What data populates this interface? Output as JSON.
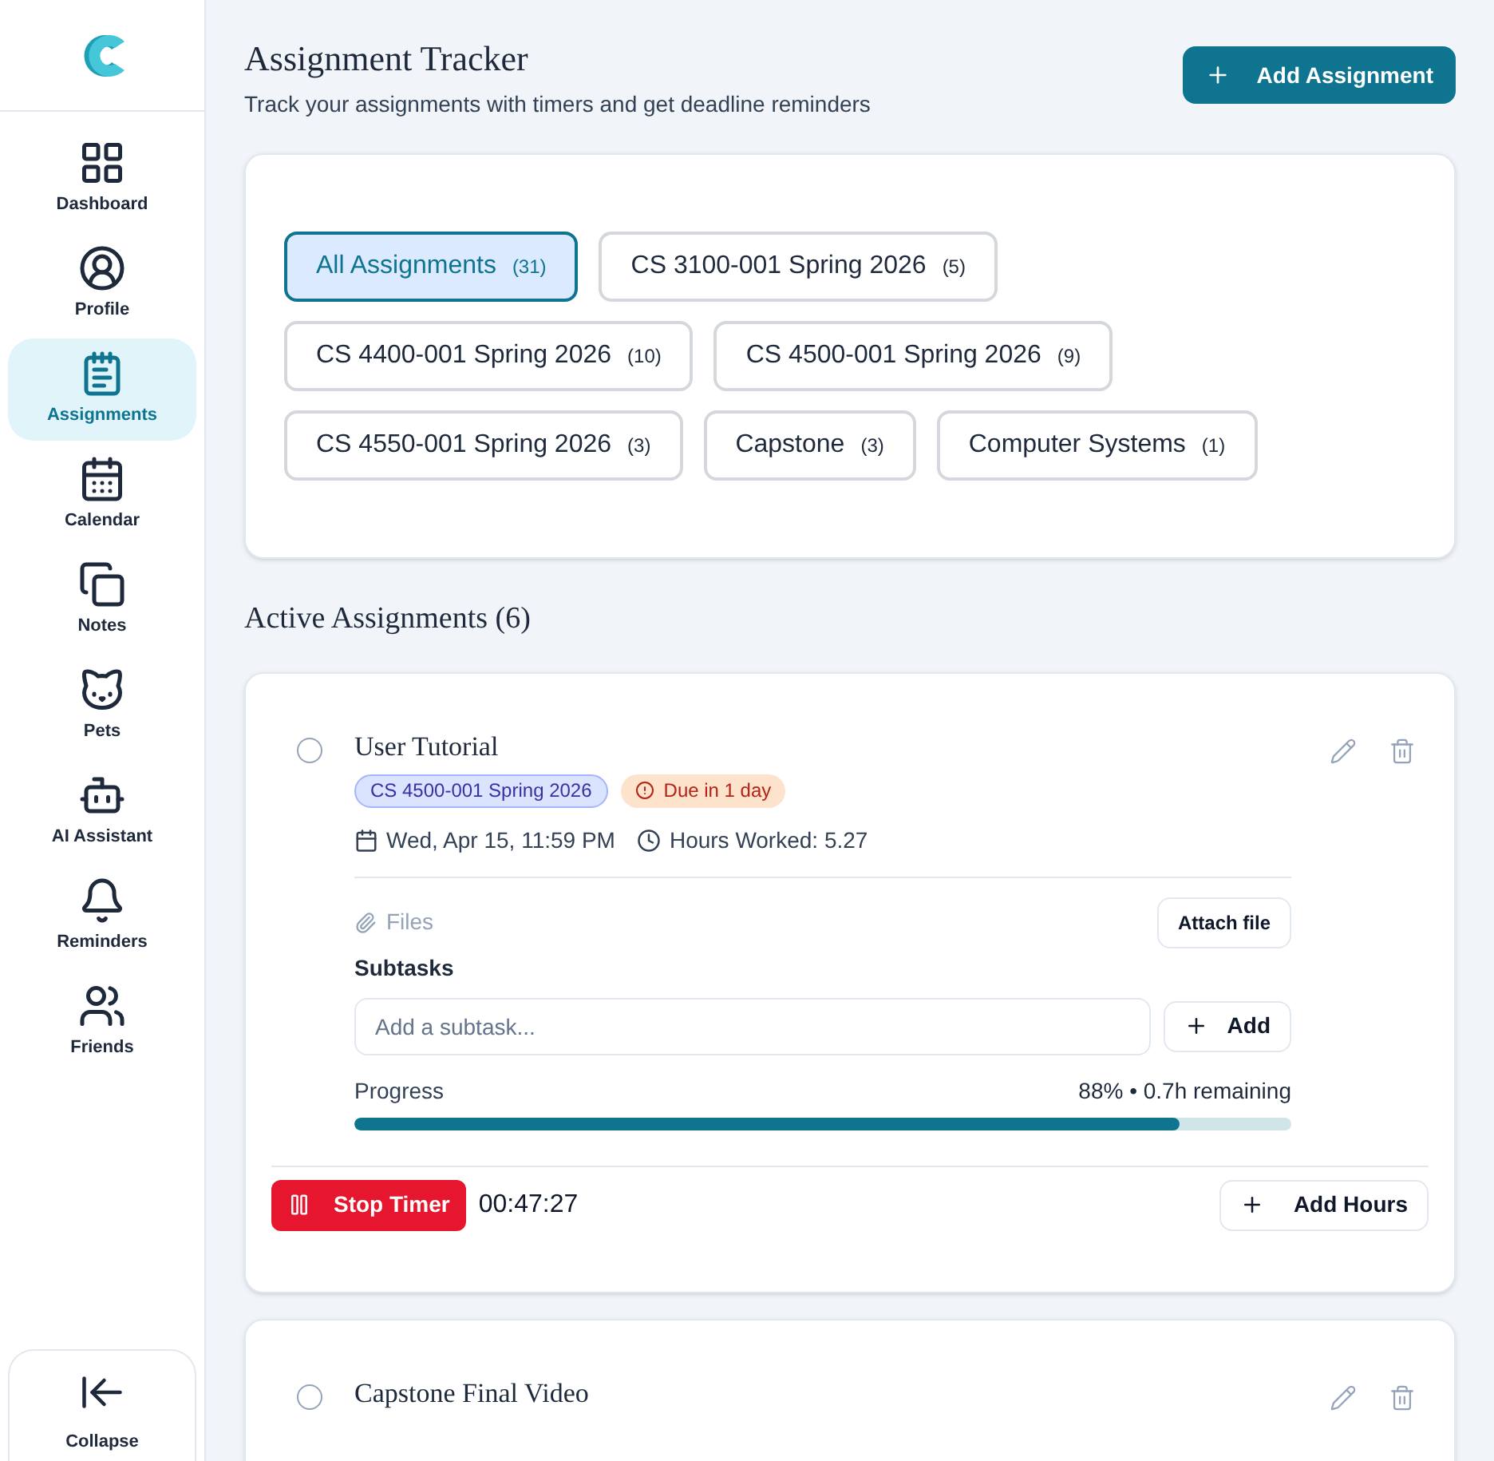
{
  "sidebar": {
    "items": [
      {
        "label": "Dashboard",
        "selected": false
      },
      {
        "label": "Profile",
        "selected": false
      },
      {
        "label": "Assignments",
        "selected": true
      },
      {
        "label": "Calendar",
        "selected": false
      },
      {
        "label": "Notes",
        "selected": false
      },
      {
        "label": "Pets",
        "selected": false
      },
      {
        "label": "AI Assistant",
        "selected": false
      },
      {
        "label": "Reminders",
        "selected": false
      },
      {
        "label": "Friends",
        "selected": false
      }
    ],
    "collapse": "Collapse"
  },
  "header": {
    "title": "Assignment Tracker",
    "subtitle": "Track your assignments with timers and get deadline reminders",
    "add_button": "Add Assignment"
  },
  "filters": [
    {
      "label": "All Assignments",
      "count": "(31)",
      "selected": true
    },
    {
      "label": "CS 3100-001 Spring 2026",
      "count": "(5)",
      "selected": false
    },
    {
      "label": "CS 4400-001 Spring 2026",
      "count": "(10)",
      "selected": false
    },
    {
      "label": "CS 4500-001 Spring 2026",
      "count": "(9)",
      "selected": false
    },
    {
      "label": "CS 4550-001 Spring 2026",
      "count": "(3)",
      "selected": false
    },
    {
      "label": "Capstone",
      "count": "(3)",
      "selected": false
    },
    {
      "label": "Computer Systems",
      "count": "(1)",
      "selected": false
    }
  ],
  "section_title": "Active Assignments (6)",
  "assignments": [
    {
      "title": "User Tutorial",
      "completed": false,
      "course": "CS 4500-001 Spring 2026",
      "due": "Due in 1 day",
      "date": "Wed, Apr 15, 11:59 PM",
      "hours": "Hours Worked: 5.27",
      "expanded": true,
      "files_label": "Files",
      "attach_button": "Attach file",
      "subtasks_label": "Subtasks",
      "subtask_placeholder": "Add a subtask...",
      "add_subtask_button": "Add",
      "progress_label": "Progress",
      "progress_reading": "88% • 0.7h remaining",
      "level": 0.88,
      "timer_button": "Stop Timer",
      "timer": "00:47:27",
      "add_hours_button": "Add Hours"
    },
    {
      "title": "Capstone Final Video",
      "completed": false,
      "expanded": false
    }
  ]
}
